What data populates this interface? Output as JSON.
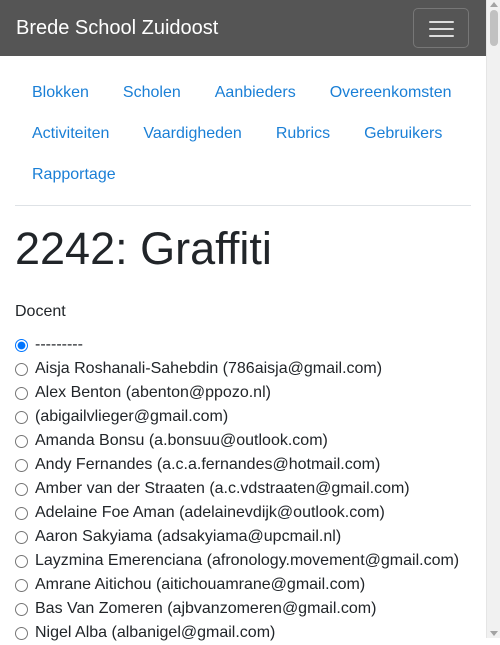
{
  "navbar": {
    "brand": "Brede School Zuidoost",
    "toggle_icon": "hamburger-menu-icon"
  },
  "nav": {
    "rows": [
      [
        "Blokken",
        "Scholen",
        "Aanbieders",
        "Overeenkomsten"
      ],
      [
        "Activiteiten",
        "Vaardigheden",
        "Rubrics",
        "Gebruikers"
      ],
      [
        "Rapportage"
      ]
    ]
  },
  "page": {
    "title": "2242: Graffiti"
  },
  "form": {
    "docent_label": "Docent",
    "selected_index": 0,
    "options": [
      "---------",
      "Aisja Roshanali-Sahebdin (786aisja@gmail.com)",
      "Alex Benton (abenton@ppozo.nl)",
      "(abigailvlieger@gmail.com)",
      "Amanda Bonsu (a.bonsuu@outlook.com)",
      "Andy Fernandes (a.c.a.fernandes@hotmail.com)",
      "Amber van der Straaten (a.c.vdstraaten@gmail.com)",
      "Adelaine Foe Aman (adelainevdijk@outlook.com)",
      "Aaron Sakyiama (adsakyiama@upcmail.nl)",
      "Layzmina Emerenciana (afronology.movement@gmail.com)",
      "Amrane Aitichou (aitichouamrane@gmail.com)",
      "Bas Van Zomeren (ajbvanzomeren@gmail.com)",
      "Nigel Alba (albanigel@gmail.com)"
    ]
  },
  "colors": {
    "navbar_bg": "#555555",
    "link": "#1a7fd6",
    "text": "#212529"
  }
}
